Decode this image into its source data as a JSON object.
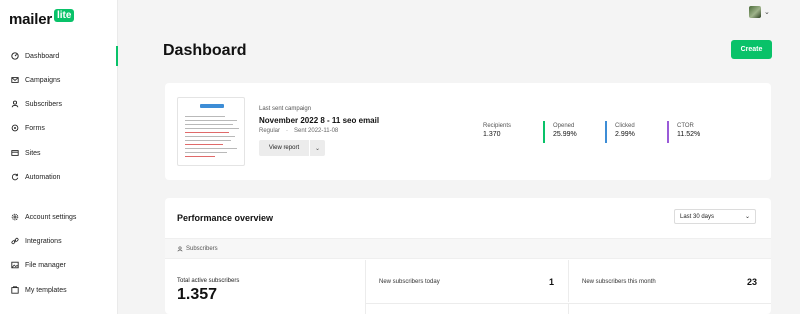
{
  "app": {
    "logo_text": "mailer",
    "logo_badge": "lite"
  },
  "sidebar": {
    "items": [
      {
        "label": "Dashboard",
        "icon": "dashboard-icon"
      },
      {
        "label": "Campaigns",
        "icon": "mail-icon"
      },
      {
        "label": "Subscribers",
        "icon": "user-icon"
      },
      {
        "label": "Forms",
        "icon": "forms-icon"
      },
      {
        "label": "Sites",
        "icon": "sites-icon"
      },
      {
        "label": "Automation",
        "icon": "automation-icon"
      },
      {
        "label": "Account settings",
        "icon": "gear-icon"
      },
      {
        "label": "Integrations",
        "icon": "link-icon"
      },
      {
        "label": "File manager",
        "icon": "image-icon"
      },
      {
        "label": "My templates",
        "icon": "templates-icon"
      }
    ],
    "active": "Dashboard"
  },
  "header": {
    "title": "Dashboard",
    "create_label": "Create"
  },
  "campaign": {
    "section_label": "Last sent campaign",
    "name": "November 2022 8 - 11 seo email",
    "type": "Regular",
    "sent": "Sent 2022-11-08",
    "view_report_label": "View report",
    "stats": [
      {
        "label": "Recipients",
        "value": "1.370",
        "color": "#ffffff"
      },
      {
        "label": "Opened",
        "value": "25.99%",
        "color": "#09c269"
      },
      {
        "label": "Clicked",
        "value": "2.99%",
        "color": "#3d8dd6"
      },
      {
        "label": "CTOR",
        "value": "11.52%",
        "color": "#9a5bd8"
      }
    ]
  },
  "performance": {
    "title": "Performance overview",
    "range": "Last 30 days",
    "section_label": "Subscribers",
    "total_label": "Total active subscribers",
    "total_value": "1.357",
    "today_label": "New subscribers today",
    "today_value": "1",
    "month_label": "New subscribers this month",
    "month_value": "23"
  },
  "colors": {
    "accent": "#09c269",
    "background": "#f4f4f4"
  }
}
